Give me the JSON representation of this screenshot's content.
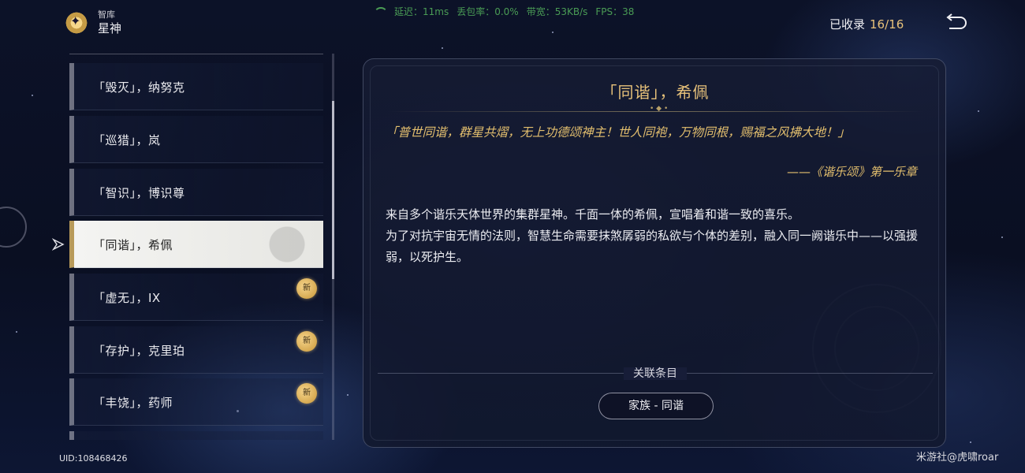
{
  "header": {
    "sub": "智库",
    "title": "星神"
  },
  "netstats": {
    "latency": "延迟：11ms",
    "loss": "丢包率：0.0%",
    "bandwidth": "带宽：53KB/s",
    "fps": "FPS：38"
  },
  "collection": {
    "label": "已收录",
    "count": "16/16"
  },
  "list": {
    "items": [
      {
        "label": "「毁灭」，纳努克",
        "new": false,
        "selected": false
      },
      {
        "label": "「巡猎」，岚",
        "new": false,
        "selected": false
      },
      {
        "label": "「智识」，博识尊",
        "new": false,
        "selected": false
      },
      {
        "label": "「同谐」，希佩",
        "new": false,
        "selected": true
      },
      {
        "label": "「虚无」，IX",
        "new": true,
        "selected": false
      },
      {
        "label": "「存护」，克里珀",
        "new": true,
        "selected": false
      },
      {
        "label": "「丰饶」，药师",
        "new": true,
        "selected": false
      }
    ],
    "new_badge": "新"
  },
  "uid": "UID:108468426",
  "detail": {
    "title": "「同谐」，希佩",
    "quote": "「普世同谐，群星共熠，无上功德颂神主！世人同袍，万物同根，赐福之风拂大地！」",
    "quote_source": "——《谐乐颂》第一乐章",
    "description": [
      "来自多个谐乐天体世界的集群星神。千面一体的希佩，宣唱着和谐一致的喜乐。",
      "为了对抗宇宙无情的法则，智慧生命需要抹煞孱弱的私欲与个体的差别，融入同一阙谐乐中——以强援弱，以死护生。"
    ],
    "related_label": "关联条目",
    "related_button": "家族 - 同谐"
  },
  "watermark": "米游社@虎啸roar",
  "colors": {
    "accent_gold": "#e8c27a",
    "net_green": "#4a9c55",
    "selected_bg": "#f4f4f2"
  }
}
